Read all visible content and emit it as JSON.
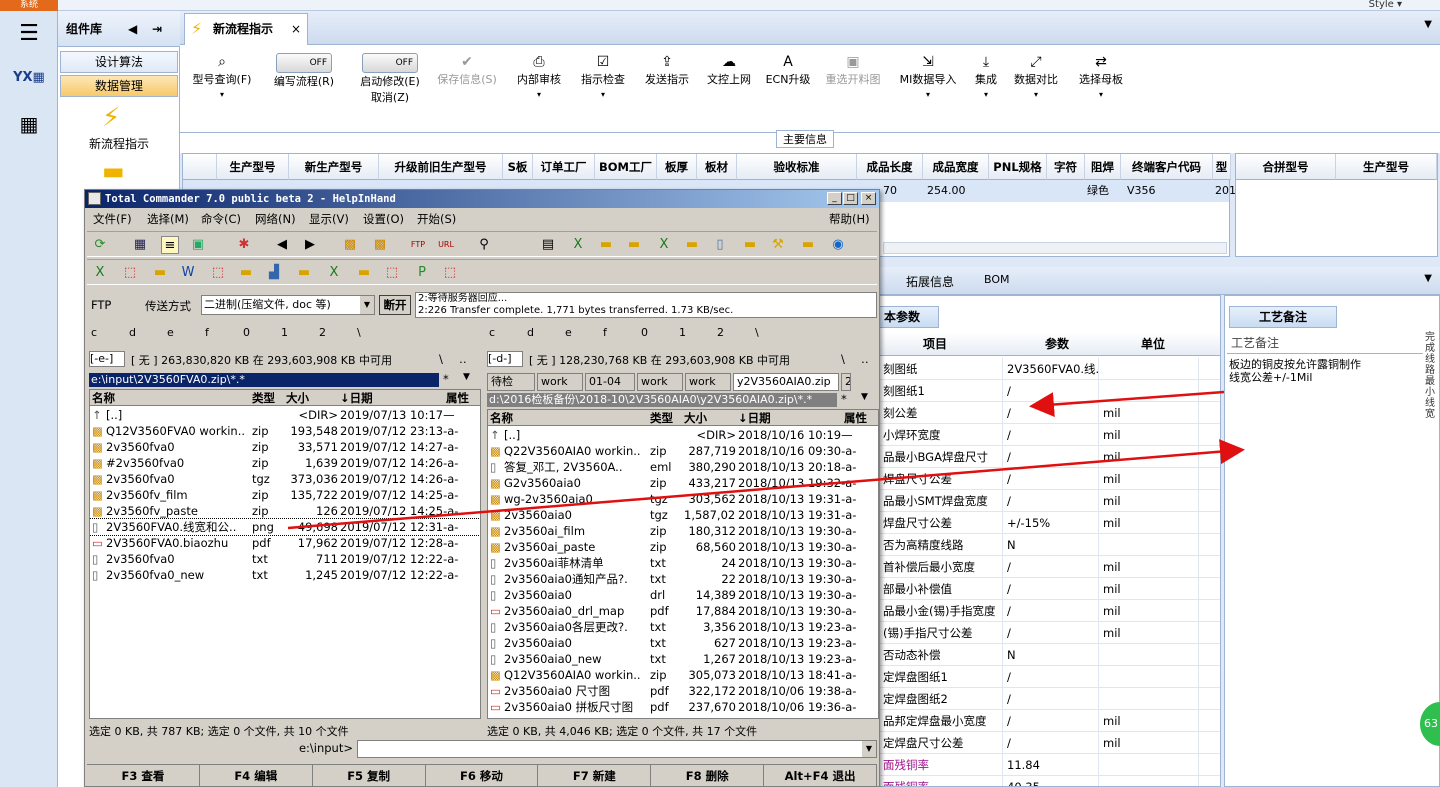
{
  "topbar": {
    "system_tab": "系统",
    "style_menu": "Style ▾"
  },
  "complib": {
    "title": "组件库",
    "items": [
      "设计算法",
      "数据管理"
    ],
    "new_flow": "新流程指示"
  },
  "doc_tab": {
    "label": "新流程指示",
    "close": "×"
  },
  "toolbar": {
    "off": "OFF",
    "buttons": [
      "型号查询(F)",
      "编写流程(R)",
      "启动修改(E)",
      "取消(Z)",
      "保存信息(S)",
      "内部审核",
      "指示检查",
      "发送指示",
      "文控上网",
      "ECN升级",
      "重选开料图",
      "MI数据导入",
      "集成",
      "数据对比",
      "选择母板"
    ]
  },
  "main_info": "主要信息",
  "grid1": {
    "headers": [
      "生产型号",
      "新生产型号",
      "升级前旧生产型号",
      "S板",
      "订单工厂",
      "BOM工厂",
      "板厚",
      "板材",
      "验收标准",
      "成品长度",
      "成品宽度",
      "PNL规格",
      "字符",
      "阻焊",
      "终端客户代码",
      "型"
    ],
    "row": {
      "c1": "70",
      "c2": "254.00",
      "c3": "绿色",
      "c4": "V356",
      "c5": "201"
    }
  },
  "grid2": {
    "headers": [
      "合拼型号",
      "生产型号"
    ]
  },
  "subtabs": {
    "t1": "拓展信息",
    "t2": "BOM"
  },
  "param": {
    "tab": "本参数",
    "headers": [
      "项目",
      "参数",
      "单位"
    ],
    "rows": [
      [
        "刻图纸",
        "2V3560FVA0.线...",
        ""
      ],
      [
        "刻图纸1",
        "/",
        ""
      ],
      [
        "刻公差",
        "/",
        "mil"
      ],
      [
        "小焊环宽度",
        "/",
        "mil"
      ],
      [
        "品最小BGA焊盘尺寸",
        "/",
        "mil"
      ],
      [
        "焊盘尺寸公差",
        "/",
        "mil"
      ],
      [
        "品最小SMT焊盘宽度",
        "/",
        "mil"
      ],
      [
        "焊盘尺寸公差",
        "+/-15%",
        "mil"
      ],
      [
        "否为高精度线路",
        "N",
        ""
      ],
      [
        "首补偿后最小宽度",
        "/",
        "mil"
      ],
      [
        "部最小补偿值",
        "/",
        "mil"
      ],
      [
        "品最小金(锡)手指宽度",
        "/",
        "mil"
      ],
      [
        "(锡)手指尺寸公差",
        "/",
        "mil"
      ],
      [
        "否动态补偿",
        "N",
        ""
      ],
      [
        "定焊盘图纸1",
        "/",
        ""
      ],
      [
        "定焊盘图纸2",
        "/",
        ""
      ],
      [
        "品邦定焊盘最小宽度",
        "/",
        "mil"
      ],
      [
        "定焊盘尺寸公差",
        "/",
        "mil"
      ],
      [
        "面残铜率",
        "11.84",
        ""
      ],
      [
        "面残铜率",
        "40.35",
        ""
      ]
    ]
  },
  "craft": {
    "tab": "工艺备注",
    "header": "工艺备注",
    "note": "板边的铜皮按允许露铜制作\n线宽公差+/-1Mil",
    "side": "完成线路最小线宽"
  },
  "tc": {
    "title": "Total Commander 7.0 public beta 2 - HelpInHand",
    "menu": [
      "文件(F)",
      "选择(M)",
      "命令(C)",
      "网络(N)",
      "显示(V)",
      "设置(O)",
      "开始(S)"
    ],
    "help": "帮助(H)",
    "ftp_label": "FTP",
    "transfer_label": "传送方式",
    "transfer_value": "二进制(压缩文件, doc 等)",
    "disconnect": "断开",
    "log1": "2:等待服务器回应...",
    "log2": "2:226 Transfer complete. 1,771 bytes transferred. 1.73 KB/sec.",
    "left": {
      "drives": [
        "c",
        "d",
        "e",
        "f",
        "0",
        "1",
        "2",
        "\\"
      ],
      "drive_sel": "[-e-]",
      "free": "[ 无 ]  263,830,820 KB 在 293,603,908 KB 中可用",
      "path": "e:\\input\\2V3560FVA0.zip\\*.*",
      "cols": [
        "名称",
        "类型",
        "大小",
        "↓日期",
        "属性"
      ],
      "files": [
        [
          "[..]",
          "",
          "<DIR>",
          "2019/07/13 10:17—"
        ],
        [
          "Q12V3560FVA0 workin..",
          "zip",
          "193,548",
          "2019/07/12 23:13-a-"
        ],
        [
          "2v3560fva0",
          "zip",
          "33,571",
          "2019/07/12 14:27-a-"
        ],
        [
          "#2v3560fva0",
          "zip",
          "1,639",
          "2019/07/12 14:26-a-"
        ],
        [
          "2v3560fva0",
          "tgz",
          "373,036",
          "2019/07/12 14:26-a-"
        ],
        [
          "2v3560fv_film",
          "zip",
          "135,722",
          "2019/07/12 14:25-a-"
        ],
        [
          "2v3560fv_paste",
          "zip",
          "126",
          "2019/07/12 14:25-a-"
        ],
        [
          "2V3560FVA0.线宽和公..",
          "png",
          "49,698",
          "2019/07/12 12:31-a-"
        ],
        [
          "2V3560FVA0.biaozhu",
          "pdf",
          "17,962",
          "2019/07/12 12:28-a-"
        ],
        [
          "2v3560fva0",
          "txt",
          "711",
          "2019/07/12 12:22-a-"
        ],
        [
          "2v3560fva0_new",
          "txt",
          "1,245",
          "2019/07/12 12:22-a-"
        ]
      ],
      "status": "选定 0 KB, 共 787 KB; 选定 0 个文件, 共 10 个文件"
    },
    "right": {
      "drives": [
        "c",
        "d",
        "e",
        "f",
        "0",
        "1",
        "2",
        "\\"
      ],
      "drive_sel": "[-d-]",
      "free": "[ 无 ]  128,230,768 KB 在 293,603,908 KB 中可用",
      "tabs": [
        "待检",
        "work",
        "01-04",
        "work",
        "work",
        "y2V3560AIA0.zip",
        "2"
      ],
      "path": "d:\\2016检板备份\\2018-10\\2V3560AIA0\\y2V3560AIA0.zip\\*.*",
      "cols": [
        "名称",
        "类型",
        "大小",
        "↓日期",
        "属性"
      ],
      "files": [
        [
          "[..]",
          "",
          "<DIR>",
          "2018/10/16 10:19—"
        ],
        [
          "Q22V3560AIA0 workin..",
          "zip",
          "287,719",
          "2018/10/16 09:30-a-"
        ],
        [
          "答复_邓工, 2V3560A..",
          "eml",
          "380,290",
          "2018/10/13 20:18-a-"
        ],
        [
          "G2v3560aia0",
          "zip",
          "433,217",
          "2018/10/13 19:32-a-"
        ],
        [
          "wg-2v3560aia0",
          "tgz",
          "303,562",
          "2018/10/13 19:31-a-"
        ],
        [
          "2v3560aia0",
          "tgz",
          "1,587,021",
          "2018/10/13 19:31-a-"
        ],
        [
          "2v3560ai_film",
          "zip",
          "180,312",
          "2018/10/13 19:30-a-"
        ],
        [
          "2v3560ai_paste",
          "zip",
          "68,560",
          "2018/10/13 19:30-a-"
        ],
        [
          "2v3560ai菲林清单",
          "txt",
          "24",
          "2018/10/13 19:30-a-"
        ],
        [
          "2v3560aia0通知产品?.",
          "txt",
          "22",
          "2018/10/13 19:30-a-"
        ],
        [
          "2v3560aia0",
          "drl",
          "14,389",
          "2018/10/13 19:30-a-"
        ],
        [
          "2v3560aia0_drl_map",
          "pdf",
          "17,884",
          "2018/10/13 19:30-a-"
        ],
        [
          "2v3560aia0各层更改?.",
          "txt",
          "3,356",
          "2018/10/13 19:23-a-"
        ],
        [
          "2v3560aia0",
          "txt",
          "627",
          "2018/10/13 19:23-a-"
        ],
        [
          "2v3560aia0_new",
          "txt",
          "1,267",
          "2018/10/13 19:23-a-"
        ],
        [
          "Q12V3560AIA0 workin..",
          "zip",
          "305,073",
          "2018/10/13 18:41-a-"
        ],
        [
          "2v3560aia0 尺寸图",
          "pdf",
          "322,172",
          "2018/10/06 19:38-a-"
        ],
        [
          "2v3560aia0 拼板尺寸图",
          "pdf",
          "237,670",
          "2018/10/06 19:36-a-"
        ]
      ],
      "status": "选定 0 KB, 共 4,046 KB; 选定 0 个文件, 共 17 个文件"
    },
    "cmd_label": "e:\\input>",
    "fkeys": [
      "F3 查看",
      "F4 编辑",
      "F5 复制",
      "F6 移动",
      "F7 新建",
      "F8 删除",
      "Alt+F4 退出"
    ]
  },
  "badge": "63"
}
